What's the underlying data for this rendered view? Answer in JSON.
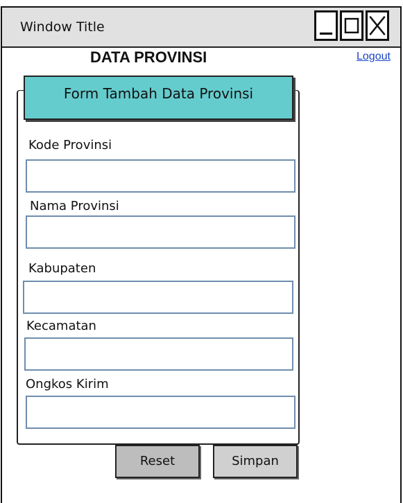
{
  "window": {
    "title": "Window Title",
    "controls": [
      "minimize-icon",
      "maximize-icon",
      "close-icon"
    ]
  },
  "page": {
    "title": "DATA PROVINSI",
    "logout_label": "Logout"
  },
  "form": {
    "header": "Form Tambah Data Provinsi",
    "fields": [
      {
        "label": "Kode Provinsi",
        "value": ""
      },
      {
        "label": "Nama Provinsi",
        "value": ""
      },
      {
        "label": "Kabupaten",
        "value": ""
      },
      {
        "label": "Kecamatan",
        "value": ""
      },
      {
        "label": "Ongkos Kirim",
        "value": ""
      }
    ],
    "reset_label": "Reset",
    "save_label": "Simpan"
  },
  "colors": {
    "form_header_bg": "#65ccce",
    "link": "#1a44c8",
    "titlebar_bg": "#e1e1e1"
  }
}
